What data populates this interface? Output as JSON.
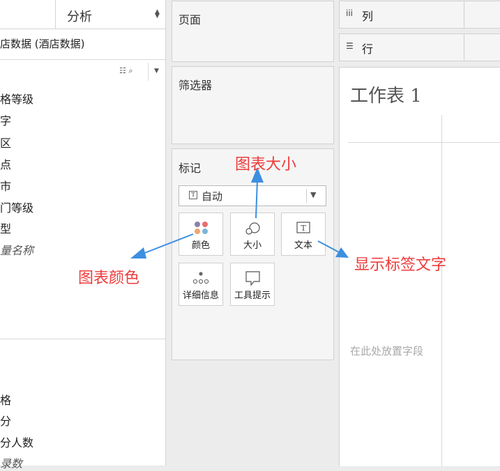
{
  "data_pane": {
    "analysis_tab": "分析",
    "datasource": "店数据 (酒店数据)",
    "dimensions": [
      "格等级",
      "字",
      "区",
      "点",
      "市",
      "门等级",
      "型"
    ],
    "dimensions_extra": "量名称",
    "measures": [
      "格",
      "分",
      "分人数"
    ],
    "measures_extra": "录数"
  },
  "shelves": {
    "pages": "页面",
    "filters": "筛选器",
    "marks": "标记",
    "marks_type": "自动",
    "columns": "列",
    "rows": "行"
  },
  "marks_buttons": {
    "color": "颜色",
    "size": "大小",
    "text": "文本",
    "detail": "详细信息",
    "tooltip": "工具提示"
  },
  "sheet": {
    "title": "工作表 1",
    "drop_hint": "在此处放置字段"
  },
  "annotations": {
    "size_note": "图表大小",
    "color_note": "图表颜色",
    "label_note": "显示标签文字",
    "color": "#ee3b3b",
    "arrow_color": "#3d8fe0"
  },
  "colors": {
    "shelf_bg": "#f5f5f5",
    "border": "#d0d0d0",
    "color_dots": [
      "#8e7fa8",
      "#e86f6f",
      "#f0a46e",
      "#7cb4d8"
    ]
  }
}
